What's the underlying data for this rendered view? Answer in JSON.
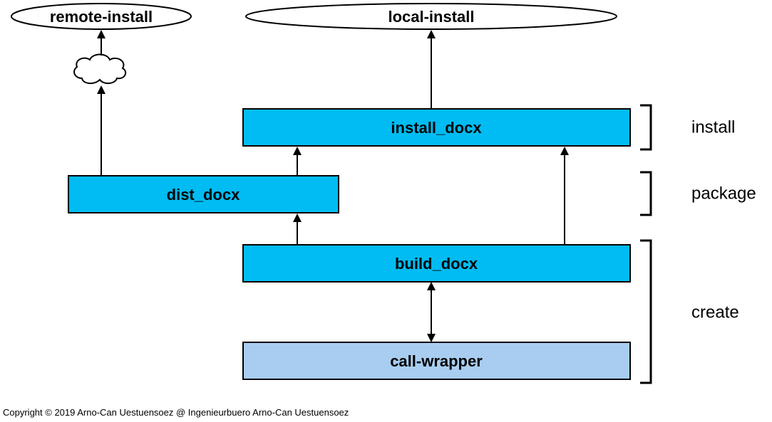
{
  "nodes": {
    "remote_install": "remote-install",
    "local_install": "local-install",
    "install_docx": "install_docx",
    "dist_docx": "dist_docx",
    "build_docx": "build_docx",
    "call_wrapper": "call-wrapper"
  },
  "phases": {
    "install": "install",
    "package": "package",
    "create": "create"
  },
  "copyright": "Copyright © 2019 Arno-Can Uestuensoez @ Ingenieurbuero Arno-Can Uestuensoez"
}
